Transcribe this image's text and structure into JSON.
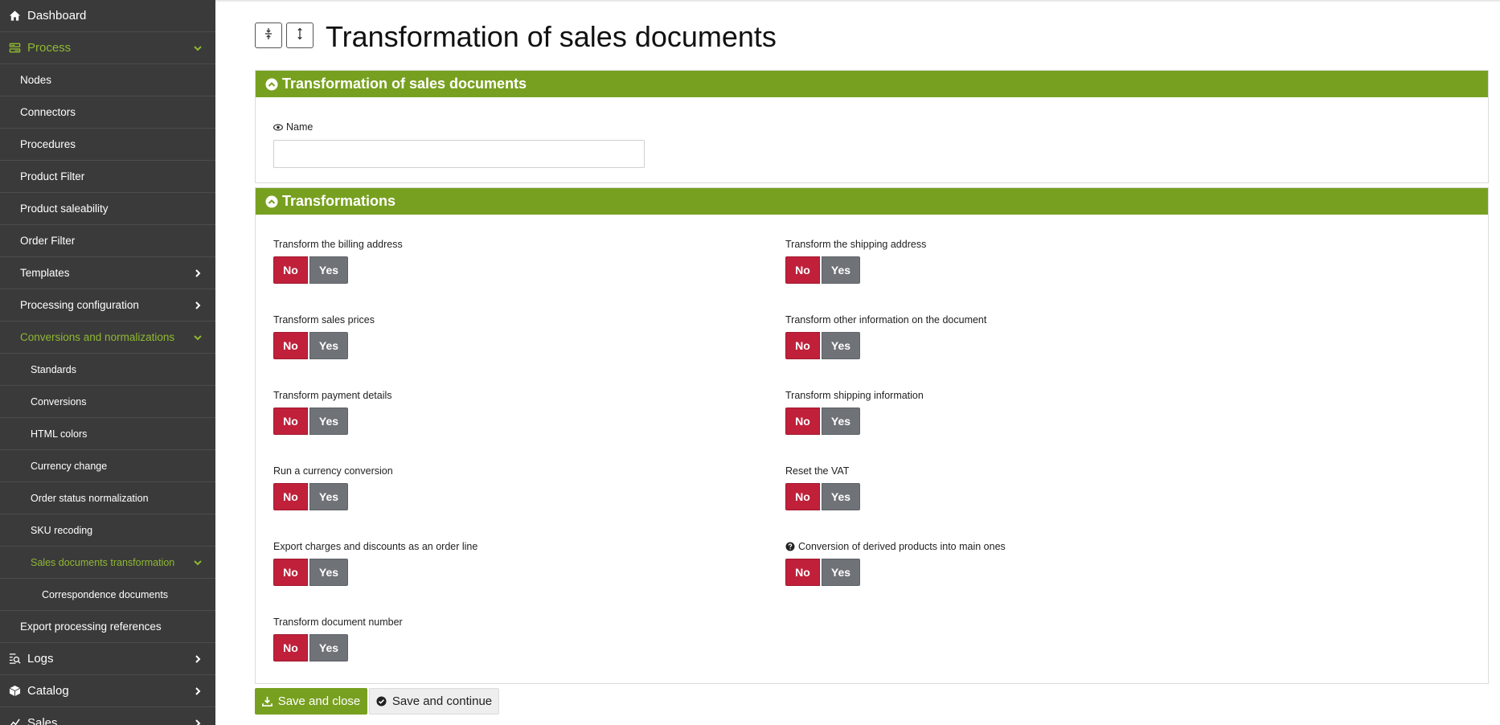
{
  "sidebar": {
    "items": [
      {
        "label": "Dashboard"
      },
      {
        "label": "Process"
      },
      {
        "label": "Nodes"
      },
      {
        "label": "Connectors"
      },
      {
        "label": "Procedures"
      },
      {
        "label": "Product Filter"
      },
      {
        "label": "Product saleability"
      },
      {
        "label": "Order Filter"
      },
      {
        "label": "Templates"
      },
      {
        "label": "Processing configuration"
      },
      {
        "label": "Conversions and normalizations"
      },
      {
        "label": "Standards"
      },
      {
        "label": "Conversions"
      },
      {
        "label": "HTML colors"
      },
      {
        "label": "Currency change"
      },
      {
        "label": "Order status normalization"
      },
      {
        "label": "SKU recoding"
      },
      {
        "label": "Sales documents transformation"
      },
      {
        "label": "Correspondence documents"
      },
      {
        "label": "Export processing references"
      },
      {
        "label": "Logs"
      },
      {
        "label": "Catalog"
      },
      {
        "label": "Sales"
      }
    ]
  },
  "page": {
    "title": "Transformation of sales documents"
  },
  "panel_main": {
    "title": "Transformation of sales documents",
    "name_label": "Name",
    "name_value": ""
  },
  "panel_transformations": {
    "title": "Transformations",
    "fields": [
      {
        "label": "Transform the billing address",
        "no": "No",
        "yes": "Yes"
      },
      {
        "label": "Transform the shipping address",
        "no": "No",
        "yes": "Yes"
      },
      {
        "label": "Transform sales prices",
        "no": "No",
        "yes": "Yes"
      },
      {
        "label": "Transform other information on the document",
        "no": "No",
        "yes": "Yes"
      },
      {
        "label": "Transform payment details",
        "no": "No",
        "yes": "Yes"
      },
      {
        "label": "Transform shipping information",
        "no": "No",
        "yes": "Yes"
      },
      {
        "label": "Run a currency conversion",
        "no": "No",
        "yes": "Yes"
      },
      {
        "label": "Reset the VAT",
        "no": "No",
        "yes": "Yes"
      },
      {
        "label": "Export charges and discounts as an order line",
        "no": "No",
        "yes": "Yes"
      },
      {
        "label": "Conversion of derived products into main ones",
        "no": "No",
        "yes": "Yes"
      },
      {
        "label": "Transform document number",
        "no": "No",
        "yes": "Yes"
      }
    ]
  },
  "actions": {
    "save_close": "Save and close",
    "save_continue": "Save and continue"
  },
  "colors": {
    "accent_green": "#78a020",
    "no_red": "#c0203a",
    "yes_gray": "#6f7378",
    "sidebar_bg": "#3a3a3a",
    "active_text": "#8fb832"
  }
}
